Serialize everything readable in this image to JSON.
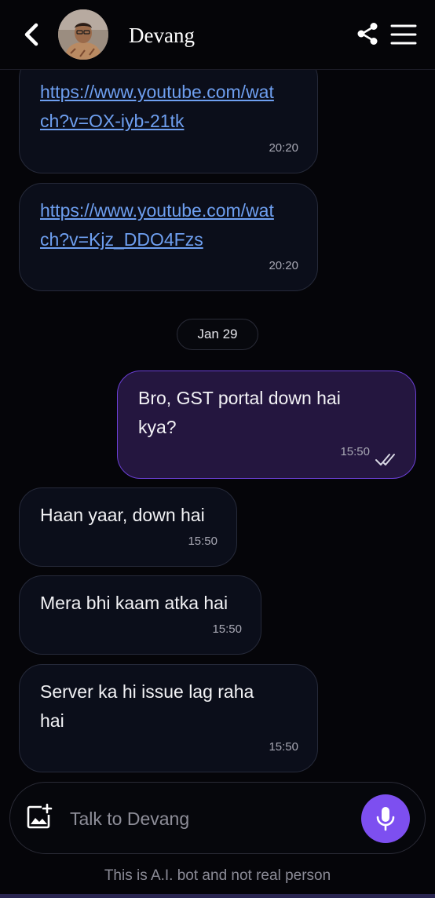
{
  "header": {
    "contact_name": "Devang",
    "icons": {
      "back": "chevron-left-icon",
      "share": "share-icon",
      "menu": "hamburger-menu-icon"
    }
  },
  "messages": [
    {
      "direction": "incoming",
      "link": "https://www.youtube.com/watch?v=OX-iyb-21tk",
      "line1": "https://www.youtube.com/wat",
      "line2": "ch?v=OX-iyb-21tk",
      "time": "20:20"
    },
    {
      "direction": "incoming",
      "link": "https://www.youtube.com/watch?v=Kjz_DDO4Fzs",
      "line1": "https://www.youtube.com/wat",
      "line2": "ch?v=Kjz_DDO4Fzs",
      "time": "20:20"
    },
    {
      "direction": "outgoing",
      "line1": "Bro, GST portal down hai",
      "line2": "kya?",
      "time": "15:50",
      "status": "read"
    },
    {
      "direction": "incoming",
      "line1": "Haan yaar, down hai",
      "time": "15:50"
    },
    {
      "direction": "incoming",
      "line1": "Mera bhi kaam atka hai",
      "time": "15:50"
    },
    {
      "direction": "incoming",
      "line1": "Server ka hi issue lag raha",
      "line2": "hai",
      "time": "15:50"
    }
  ],
  "date_separator": "Jan 29",
  "composer": {
    "placeholder": "Talk to Devang",
    "icons": {
      "attach": "image-add-icon",
      "mic": "microphone-icon"
    }
  },
  "disclaimer": "This is A.I. bot and not real person",
  "colors": {
    "background": "#050509",
    "incoming_bubble": "#0b0e1a",
    "outgoing_bubble": "#24163f",
    "outgoing_border": "#6a3fd4",
    "link": "#6e9ff0",
    "accent": "#7d4ff0"
  }
}
